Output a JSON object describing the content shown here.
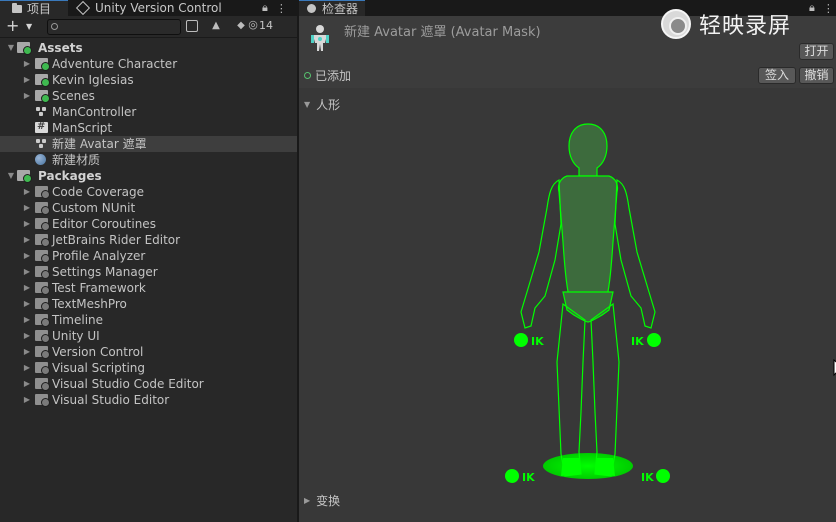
{
  "project_panel": {
    "tab_project": "项目",
    "tab_vcs": "Unity Version Control",
    "add_symbol": "+",
    "hidden_count": "14",
    "search": {
      "value": ""
    },
    "tree": [
      {
        "label": "Assets",
        "level": 0,
        "type": "root",
        "expanded": true
      },
      {
        "label": "Adventure Character",
        "level": 1,
        "type": "folder"
      },
      {
        "label": "Kevin Iglesias",
        "level": 1,
        "type": "folder"
      },
      {
        "label": "Scenes",
        "level": 1,
        "type": "folder"
      },
      {
        "label": "ManController",
        "level": 1,
        "type": "controller"
      },
      {
        "label": "ManScript",
        "level": 1,
        "type": "script"
      },
      {
        "label": "新建 Avatar 遮罩",
        "level": 1,
        "type": "avatarmask",
        "selected": true
      },
      {
        "label": "新建材质",
        "level": 1,
        "type": "material"
      },
      {
        "label": "Packages",
        "level": 0,
        "type": "root",
        "expanded": true
      },
      {
        "label": "Code Coverage",
        "level": 1,
        "type": "package"
      },
      {
        "label": "Custom NUnit",
        "level": 1,
        "type": "package"
      },
      {
        "label": "Editor Coroutines",
        "level": 1,
        "type": "package"
      },
      {
        "label": "JetBrains Rider Editor",
        "level": 1,
        "type": "package"
      },
      {
        "label": "Profile Analyzer",
        "level": 1,
        "type": "package"
      },
      {
        "label": "Settings Manager",
        "level": 1,
        "type": "package"
      },
      {
        "label": "Test Framework",
        "level": 1,
        "type": "package"
      },
      {
        "label": "TextMeshPro",
        "level": 1,
        "type": "package"
      },
      {
        "label": "Timeline",
        "level": 1,
        "type": "package"
      },
      {
        "label": "Unity UI",
        "level": 1,
        "type": "package"
      },
      {
        "label": "Version Control",
        "level": 1,
        "type": "package"
      },
      {
        "label": "Visual Scripting",
        "level": 1,
        "type": "package"
      },
      {
        "label": "Visual Studio Code Editor",
        "level": 1,
        "type": "package"
      },
      {
        "label": "Visual Studio Editor",
        "level": 1,
        "type": "package"
      }
    ]
  },
  "inspector": {
    "tab_label": "检查器",
    "title": "新建 Avatar 遮罩 (Avatar Mask)",
    "open_button": "打开",
    "added_label": "已添加",
    "signin_button": "签入",
    "revert_button": "撤销",
    "humanoid_section": "人形",
    "transform_section": "变换",
    "ik_label": "IK",
    "colors": {
      "active_green": "#00ff00",
      "body_fill": "#3d6b3d"
    }
  },
  "watermark": {
    "text": "轻映录屏"
  }
}
